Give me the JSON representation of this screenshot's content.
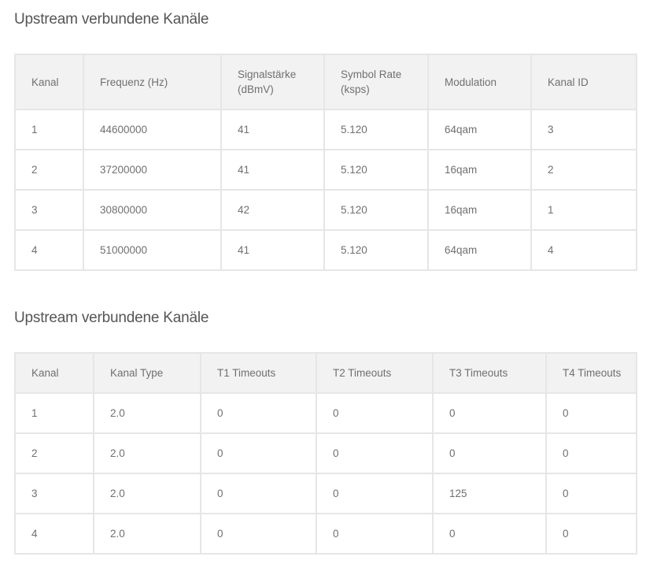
{
  "sections": [
    {
      "title": "Upstream verbundene Kanäle",
      "headers": [
        [
          "Kanal"
        ],
        [
          "Frequenz (Hz)"
        ],
        [
          "Signalstärke",
          "(dBmV)"
        ],
        [
          "Symbol Rate",
          "(ksps)"
        ],
        [
          "Modulation"
        ],
        [
          "Kanal ID"
        ]
      ],
      "rows": [
        [
          "1",
          "44600000",
          "41",
          "5.120",
          "64qam",
          "3"
        ],
        [
          "2",
          "37200000",
          "41",
          "5.120",
          "16qam",
          "2"
        ],
        [
          "3",
          "30800000",
          "42",
          "5.120",
          "16qam",
          "1"
        ],
        [
          "4",
          "51000000",
          "41",
          "5.120",
          "64qam",
          "4"
        ]
      ]
    },
    {
      "title": "Upstream verbundene Kanäle",
      "headers": [
        [
          "Kanal"
        ],
        [
          "Kanal Type"
        ],
        [
          "T1 Timeouts"
        ],
        [
          "T2 Timeouts"
        ],
        [
          "T3 Timeouts"
        ],
        [
          "T4 Timeouts"
        ]
      ],
      "rows": [
        [
          "1",
          "2.0",
          "0",
          "0",
          "0",
          "0"
        ],
        [
          "2",
          "2.0",
          "0",
          "0",
          "0",
          "0"
        ],
        [
          "3",
          "2.0",
          "0",
          "0",
          "125",
          "0"
        ],
        [
          "4",
          "2.0",
          "0",
          "0",
          "0",
          "0"
        ]
      ]
    }
  ]
}
